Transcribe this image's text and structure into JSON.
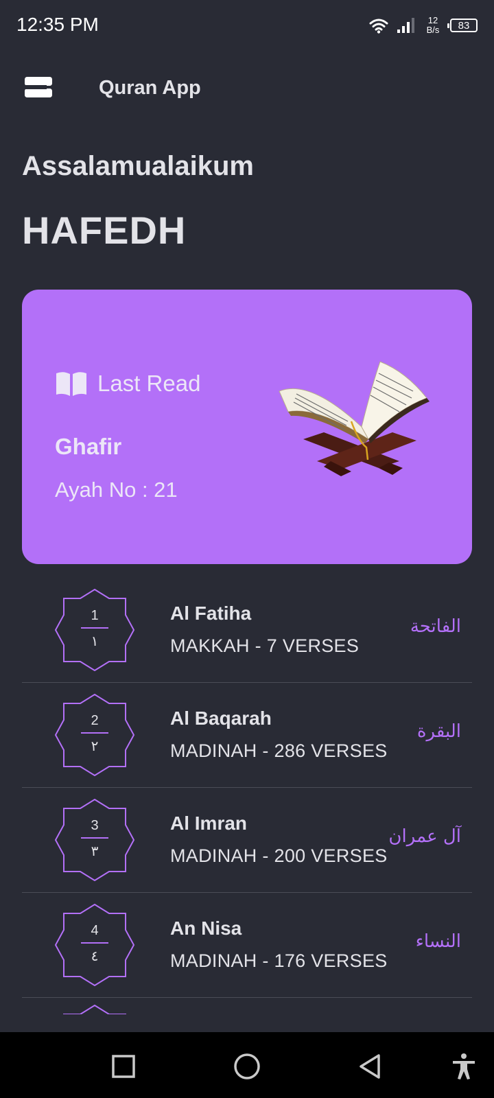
{
  "status_bar": {
    "time": "12:35 PM",
    "net_speed_value": "12",
    "net_speed_unit": "B/s",
    "battery": "83"
  },
  "app_bar": {
    "title": "Quran App"
  },
  "greeting": "Assalamualaikum",
  "username": "HAFEDH",
  "last_read": {
    "label": "Last Read",
    "surah": "Ghafir",
    "ayah": "Ayah No : 21"
  },
  "surahs": [
    {
      "number": "1",
      "arabic_number": "١",
      "name": "Al Fatiha",
      "meta": "MAKKAH - 7 VERSES",
      "arabic": "الفاتحة"
    },
    {
      "number": "2",
      "arabic_number": "٢",
      "name": "Al Baqarah",
      "meta": "MADINAH - 286 VERSES",
      "arabic": "البقرة"
    },
    {
      "number": "3",
      "arabic_number": "٣",
      "name": "Al Imran",
      "meta": "MADINAH - 200 VERSES",
      "arabic": "آل عمران"
    },
    {
      "number": "4",
      "arabic_number": "٤",
      "name": "An Nisa",
      "meta": "MADINAH - 176 VERSES",
      "arabic": "النساء"
    }
  ],
  "colors": {
    "background": "#292b35",
    "accent": "#b370f8",
    "text": "#e3e3e8",
    "divider": "#4b4d57"
  }
}
